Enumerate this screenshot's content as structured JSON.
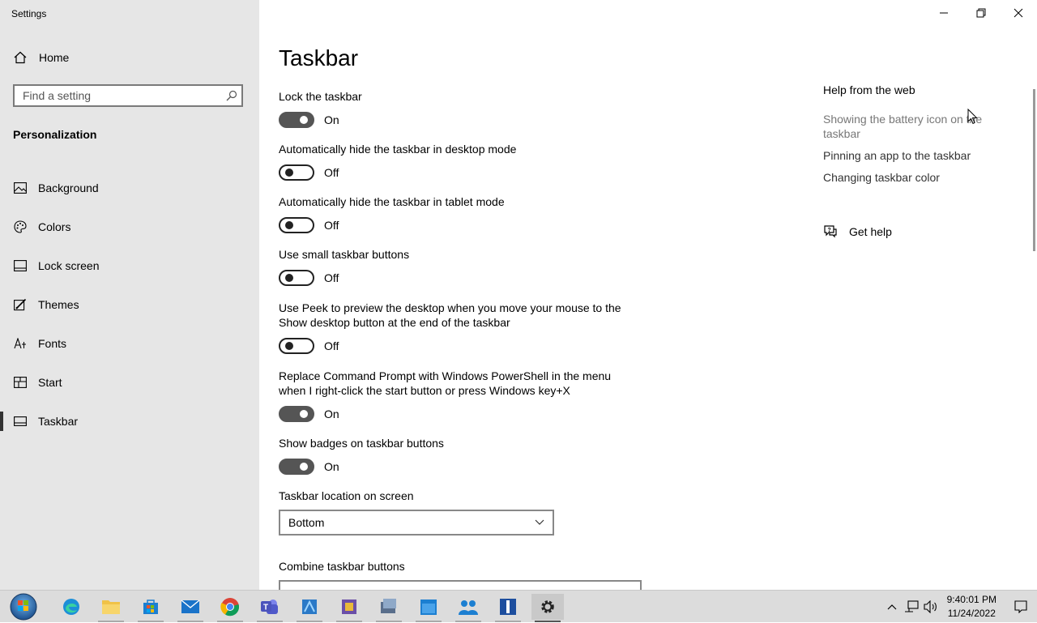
{
  "window": {
    "title": "Settings"
  },
  "sidebar": {
    "home_label": "Home",
    "search_placeholder": "Find a setting",
    "section_title": "Personalization",
    "items": [
      {
        "label": "Background",
        "icon": "image-icon"
      },
      {
        "label": "Colors",
        "icon": "palette-icon"
      },
      {
        "label": "Lock screen",
        "icon": "lock-screen-icon"
      },
      {
        "label": "Themes",
        "icon": "brush-icon"
      },
      {
        "label": "Fonts",
        "icon": "font-icon"
      },
      {
        "label": "Start",
        "icon": "start-icon"
      },
      {
        "label": "Taskbar",
        "icon": "taskbar-icon",
        "active": true
      }
    ]
  },
  "main": {
    "title": "Taskbar",
    "settings": [
      {
        "label": "Lock the taskbar",
        "state": "On"
      },
      {
        "label": "Automatically hide the taskbar in desktop mode",
        "state": "Off"
      },
      {
        "label": "Automatically hide the taskbar in tablet mode",
        "state": "Off"
      },
      {
        "label": "Use small taskbar buttons",
        "state": "Off"
      },
      {
        "label": "Use Peek to preview the desktop when you move your mouse to the Show desktop button at the end of the taskbar",
        "state": "Off"
      },
      {
        "label": "Replace Command Prompt with Windows PowerShell in the menu when I right-click the start button or press Windows key+X",
        "state": "On"
      },
      {
        "label": "Show badges on taskbar buttons",
        "state": "On"
      }
    ],
    "location_label": "Taskbar location on screen",
    "location_value": "Bottom",
    "combine_label": "Combine taskbar buttons"
  },
  "help": {
    "title": "Help from the web",
    "links": [
      "Showing the battery icon on the taskbar",
      "Pinning an app to the taskbar",
      "Changing taskbar color"
    ],
    "get_help": "Get help"
  },
  "taskbar": {
    "apps": [
      "edge-icon",
      "file-explorer-icon",
      "store-icon",
      "mail-icon",
      "chrome-icon",
      "teams-icon",
      "app-icon-1",
      "app-icon-2",
      "app-icon-3",
      "calendar-icon",
      "people-icon",
      "app-icon-4",
      "settings-icon"
    ],
    "time": "9:40:01 PM",
    "date": "11/24/2022"
  },
  "colors": {
    "sidebar_bg": "#e6e6e6",
    "toggle_on": "#555555",
    "taskbar_bg": "#dcdcdc"
  }
}
